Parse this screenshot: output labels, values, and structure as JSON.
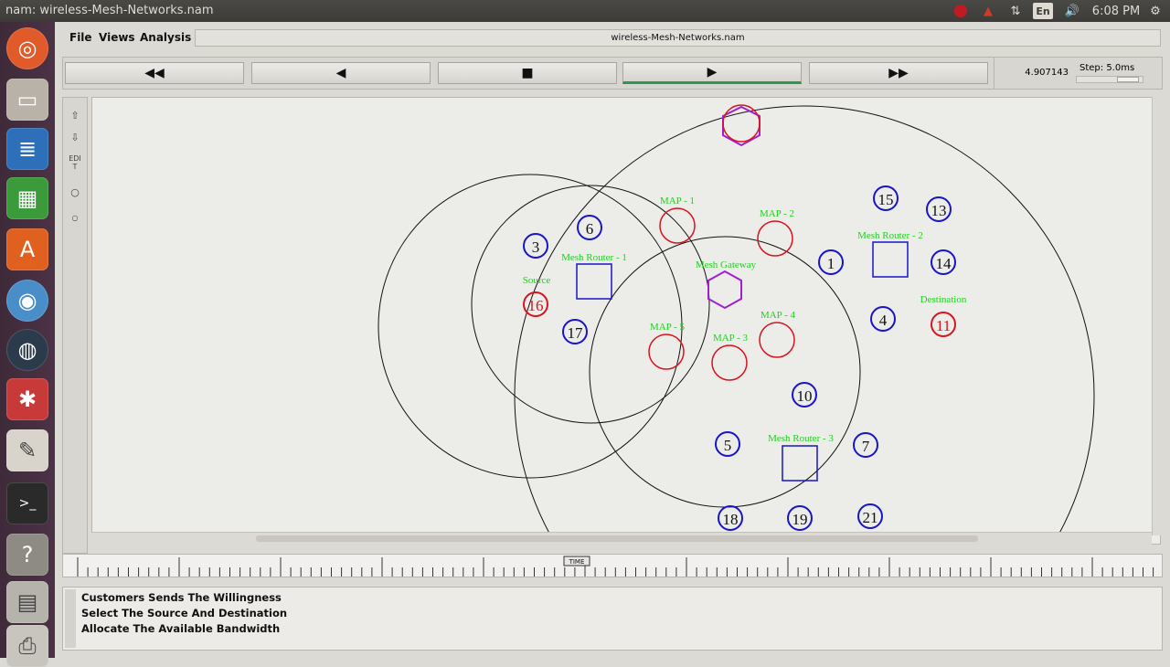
{
  "window": {
    "title": "nam: wireless-Mesh-Networks.nam"
  },
  "tray": {
    "keyboard": "En",
    "clock": "6:08 PM"
  },
  "menu": {
    "file": "File",
    "views": "Views",
    "analysis": "Analysis"
  },
  "filename": "wireless-Mesh-Networks.nam",
  "controls": {
    "rewind": "◀◀",
    "back": "◀",
    "stop": "■",
    "play": "▶",
    "fast_forward": "▶▶",
    "time": "4.907143",
    "step_label": "Step: 5.0ms"
  },
  "tools": {
    "edit_label": "EDIT"
  },
  "nodes": [
    {
      "id": "3"
    },
    {
      "id": "6"
    },
    {
      "id": "16",
      "label": "Source"
    },
    {
      "id": "17"
    },
    {
      "id": "1"
    },
    {
      "id": "15"
    },
    {
      "id": "13"
    },
    {
      "id": "14"
    },
    {
      "id": "4"
    },
    {
      "id": "11",
      "label": "Destination"
    },
    {
      "id": "10"
    },
    {
      "id": "5"
    },
    {
      "id": "7"
    },
    {
      "id": "18"
    },
    {
      "id": "19"
    },
    {
      "id": "21"
    }
  ],
  "labels": {
    "map1": "MAP - 1",
    "map2": "MAP - 2",
    "map3": "MAP - 3",
    "map4": "MAP - 4",
    "map5": "MAP - 5",
    "mesh_router_1": "Mesh Router - 1",
    "mesh_router_2": "Mesh Router - 2",
    "mesh_router_3": "Mesh Router - 3",
    "mesh_gateway": "Mesh Gateway",
    "source": "Source",
    "destination": "Destination"
  },
  "timeline": {
    "marker": "TIME"
  },
  "annotations": [
    "Customers Sends The Willingness",
    "Select The Source And Destination",
    "Allocate The Available Bandwidth"
  ],
  "colors": {
    "node_blue": "#1a14c8",
    "node_red": "#d8141e",
    "label_green": "#22d022",
    "gateway_purple": "#a020d0",
    "play_indicator": "#2c9a4a"
  }
}
